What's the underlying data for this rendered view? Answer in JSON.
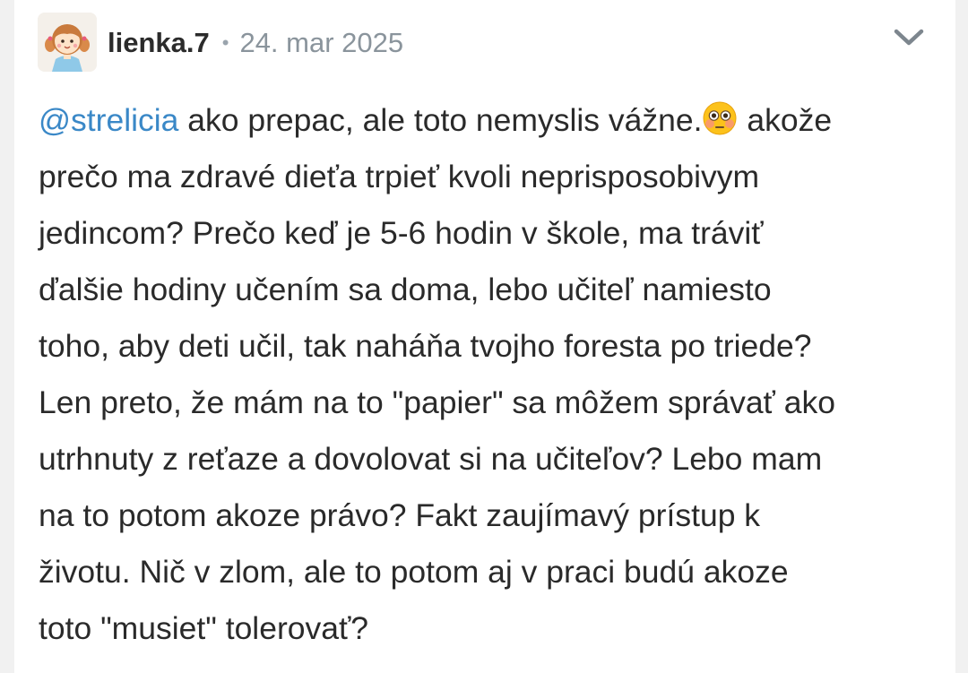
{
  "post": {
    "author": "lienka.7",
    "separator": "•",
    "date": "24. mar 2025",
    "mention": "@strelicia",
    "lines": [
      " ako prepac, ale toto nemyslis vážne.",
      " akože",
      "prečo ma zdravé dieťa trpieť kvoli neprisposobivym",
      "jedincom? Prečo keď je 5-6 hodin v škole, ma tráviť",
      "ďalšie hodiny učením sa doma, lebo učiteľ namiesto",
      "toho, aby deti učil, tak naháňa tvojho foresta po triede?",
      "Len preto, že mám na to \"papier\" sa môžem správať ako",
      "utrhnuty z reťaze a dovolovat si na učiteľov? Lebo mam",
      "na to potom akoze právo? Fakt zaujímavý prístup k",
      "životu. Nič v zlom, ale to potom aj v praci budú akoze",
      "toto \"musiet\" tolerovať?"
    ],
    "emoji": "flushed-face-emoji"
  },
  "icons": {
    "avatar": "cartoon-girl-avatar",
    "menu": "chevron-down-icon"
  },
  "colors": {
    "mention": "#3a88c7",
    "text": "#2a2a2a",
    "meta": "#8a949c",
    "background": "#f1f1f1",
    "card": "#ffffff"
  }
}
